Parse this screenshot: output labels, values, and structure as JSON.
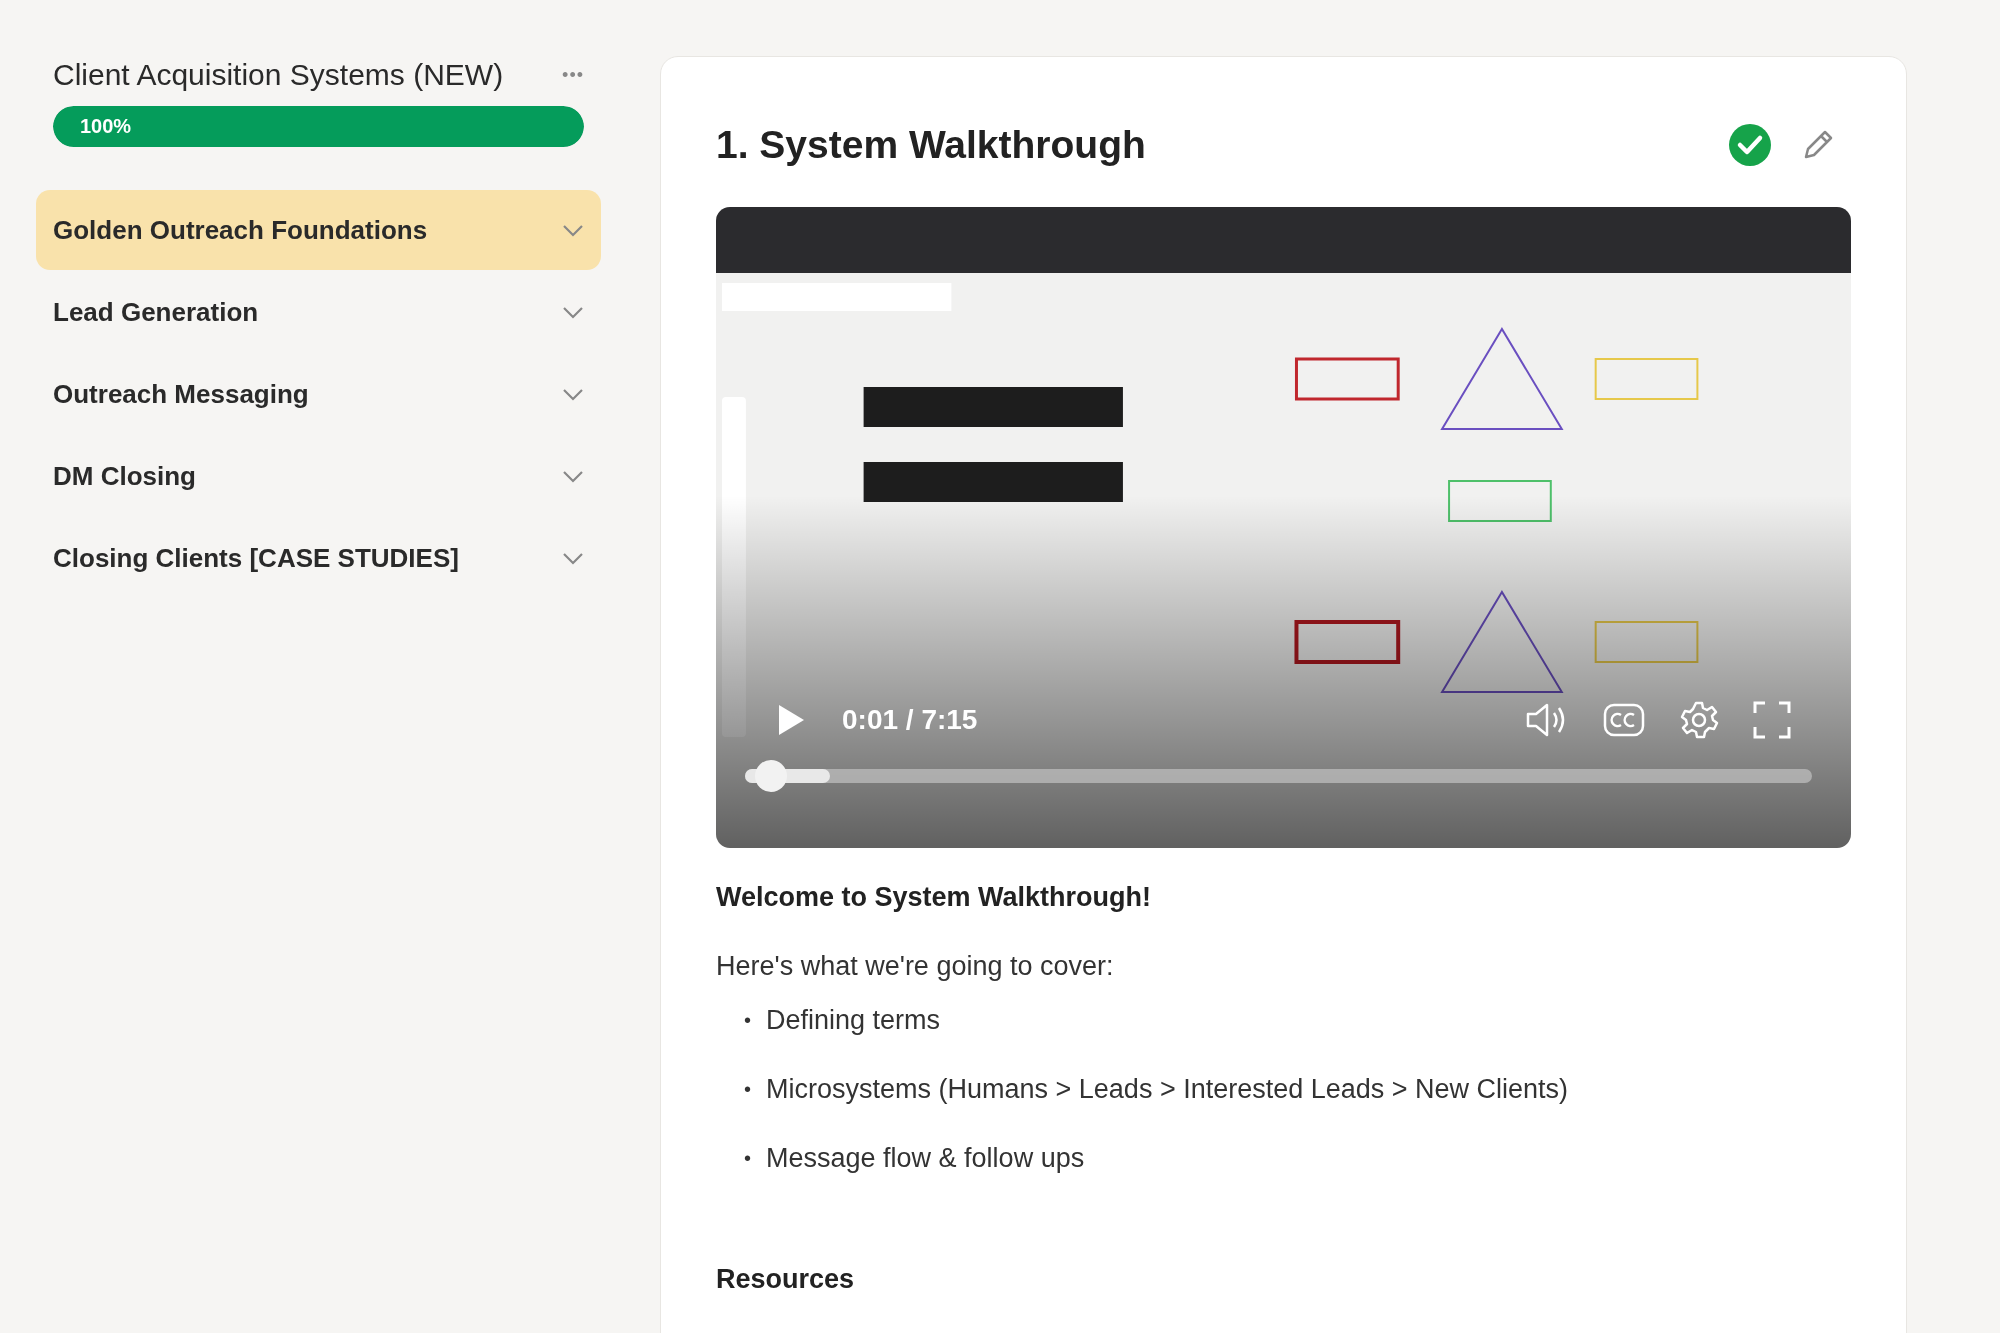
{
  "sidebar": {
    "course_title": "Client Acquisition Systems (NEW)",
    "menu_icon": "•••",
    "progress": {
      "label": "100%",
      "level": 1.0
    },
    "sections": [
      {
        "label": "Golden Outreach Foundations",
        "selected": true,
        "expanded": false
      },
      {
        "label": "Lead Generation",
        "selected": false,
        "expanded": false
      },
      {
        "label": "Outreach Messaging",
        "selected": false,
        "expanded": false
      },
      {
        "label": "DM Closing",
        "selected": false,
        "expanded": false
      },
      {
        "label": "Closing Clients [CASE STUDIES]",
        "selected": false,
        "expanded": false
      }
    ]
  },
  "lesson": {
    "title": "1. System Walkthrough",
    "completed": true,
    "video": {
      "kind": "picture",
      "playing": false,
      "time": "0:01 / 7:15",
      "progress": {
        "level": 0.01
      },
      "buffered": {
        "level": 0.08
      }
    },
    "intro_heading": "Welcome to System Walkthrough!",
    "intro_text": "Here's what we're going to cover:",
    "bullets": [
      {
        "marker": "•",
        "text": "Defining terms"
      },
      {
        "marker": "•",
        "text": "Microsystems (Humans > Leads > Interested Leads > New Clients)"
      },
      {
        "marker": "•",
        "text": "Message flow & follow ups"
      }
    ],
    "resources_heading": "Resources"
  }
}
